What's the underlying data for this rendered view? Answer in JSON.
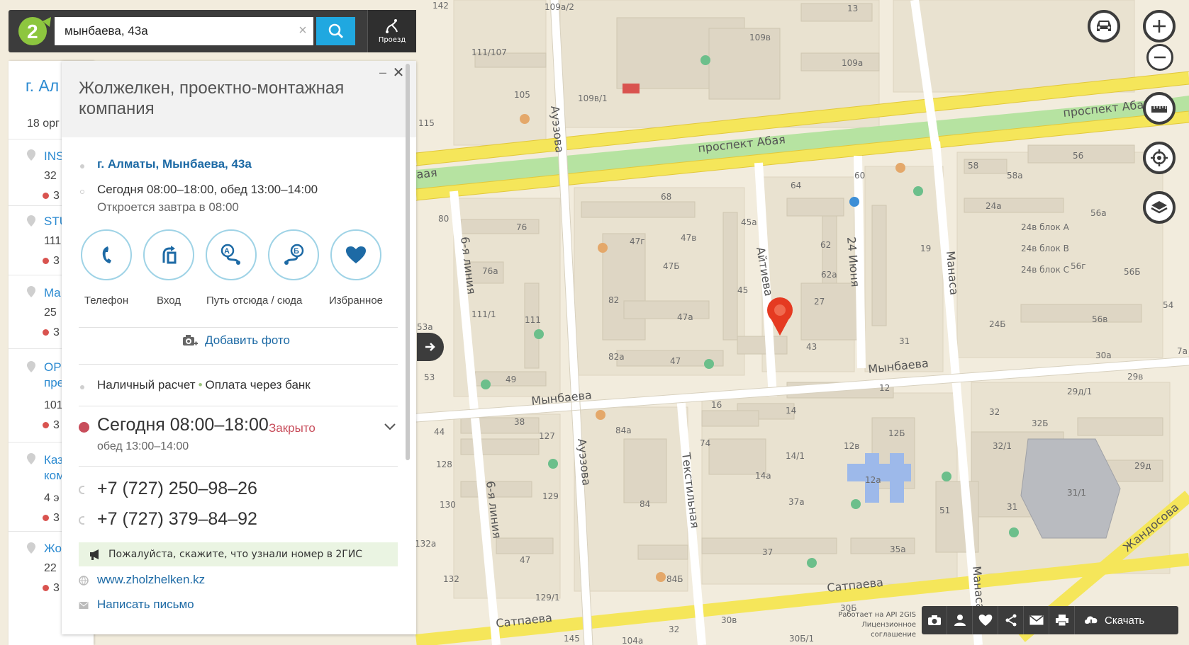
{
  "search": {
    "value": "мынбаева, 43а",
    "clear": "×",
    "route_label": "Проезд"
  },
  "list": {
    "city": "г. Ал",
    "count": "18 орг",
    "items": [
      {
        "name": "INS",
        "num": "32",
        "rate": "3"
      },
      {
        "name": "STU",
        "num": "111",
        "rate": "3"
      },
      {
        "name": "Ma",
        "num": "25",
        "rate": "3"
      },
      {
        "name": "OP",
        "name2": "пре",
        "num": "101",
        "rate": "3"
      },
      {
        "name": "Каз",
        "name2": "ком",
        "num": "4 э",
        "rate": "3"
      },
      {
        "name": "Жо",
        "num": "22",
        "rate": "3"
      }
    ]
  },
  "card": {
    "title": "Жолжелкен, проектно-монтажная компания",
    "minimize": "–",
    "close": "✕",
    "address": "г. Алматы, Мынбаева, 43а",
    "hours_today": "Сегодня 08:00–18:00, обед 13:00–14:00",
    "opens": "Откроется завтра в 08:00",
    "actions": [
      {
        "label": "Телефон",
        "icon": "phone-icon"
      },
      {
        "label": "Вход",
        "icon": "entrance-icon"
      },
      {
        "label": "Путь отсюда / сюда",
        "icon": "route-from-icon"
      },
      {
        "label": "",
        "icon": "route-to-icon"
      },
      {
        "label": "Избранное",
        "icon": "heart-icon"
      }
    ],
    "add_photo": "Добавить фото",
    "payment": [
      "Наличный расчет",
      "Оплата через банк"
    ],
    "schedule": {
      "today": "Сегодня 08:00–18:00",
      "status": "Закрыто",
      "lunch": "обед 13:00–14:00"
    },
    "phones": [
      "+7 (727) 250–98–26",
      "+7 (727) 379–84–92"
    ],
    "notice": "Пожалуйста, скажите, что узнали номер в 2ГИС",
    "website": "www.zholzhelken.kz",
    "email": "Написать письмо"
  },
  "toolbar": {
    "download": "Скачать"
  },
  "api": {
    "line1": "Работает на API 2GIS",
    "line2": "Лицензионное соглашение"
  },
  "colors": {
    "accent": "#20a8e0",
    "avenue": "#f5e65a",
    "green": "#b6e3a1",
    "closed": "#c84d5b",
    "link": "#1d6aa5"
  },
  "map": {
    "streets": [
      "проспект Абая",
      "проспект Аба",
      "Ауэзова",
      "Ауэзова",
      "Мынбаева",
      "Мынбаева",
      "Айтиева",
      "24 Июня",
      "Манаса",
      "Манаса",
      "6-я линия",
      "6-я линия",
      "Текстильная",
      "Сатпаева",
      "Сатпаева",
      "Жандосова",
      "аая"
    ],
    "labels": [
      "142",
      "109а/2",
      "13",
      "109в",
      "109а",
      "111/107",
      "105",
      "109в/1",
      "115",
      "64",
      "60",
      "58",
      "58а",
      "56",
      "80",
      "76",
      "68",
      "45а",
      "62",
      "56а",
      "24а",
      "24в блок А",
      "24в блок В",
      "24в блок С",
      "56г",
      "56Б",
      "76а",
      "47г",
      "47в",
      "47Б",
      "62а",
      "19",
      "27",
      "45",
      "82",
      "47а",
      "111/1",
      "111",
      "53а",
      "43",
      "31",
      "24Б",
      "56в",
      "54",
      "30а",
      "82а",
      "47",
      "53",
      "49",
      "12",
      "29в",
      "29д/1",
      "16",
      "14",
      "38",
      "127",
      "44",
      "84а",
      "12в",
      "12Б",
      "32",
      "32Б",
      "32/1",
      "128",
      "74",
      "14/1",
      "29д",
      "14а",
      "12а",
      "31/1",
      "130",
      "129",
      "84",
      "37а",
      "31",
      "51",
      "132а",
      "47",
      "37",
      "35а",
      "132",
      "84Б",
      "30Б",
      "30в",
      "129/1",
      "145",
      "32",
      "30Б/1",
      "104а",
      "7а"
    ]
  }
}
